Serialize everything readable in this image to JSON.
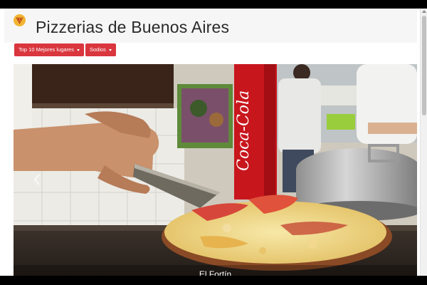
{
  "header": {
    "title": "Pizzerias de Buenos Aires",
    "logo_icon": "pizza-icon"
  },
  "toolbar": {
    "top10_label": "Top 10 Mejores lugares",
    "sodios_label": "Sodios",
    "accent_color": "#d9363e"
  },
  "carousel": {
    "caption": "El Fortín",
    "prev_icon": "chevron-left-icon",
    "sign_text": "Coca-Cola"
  }
}
